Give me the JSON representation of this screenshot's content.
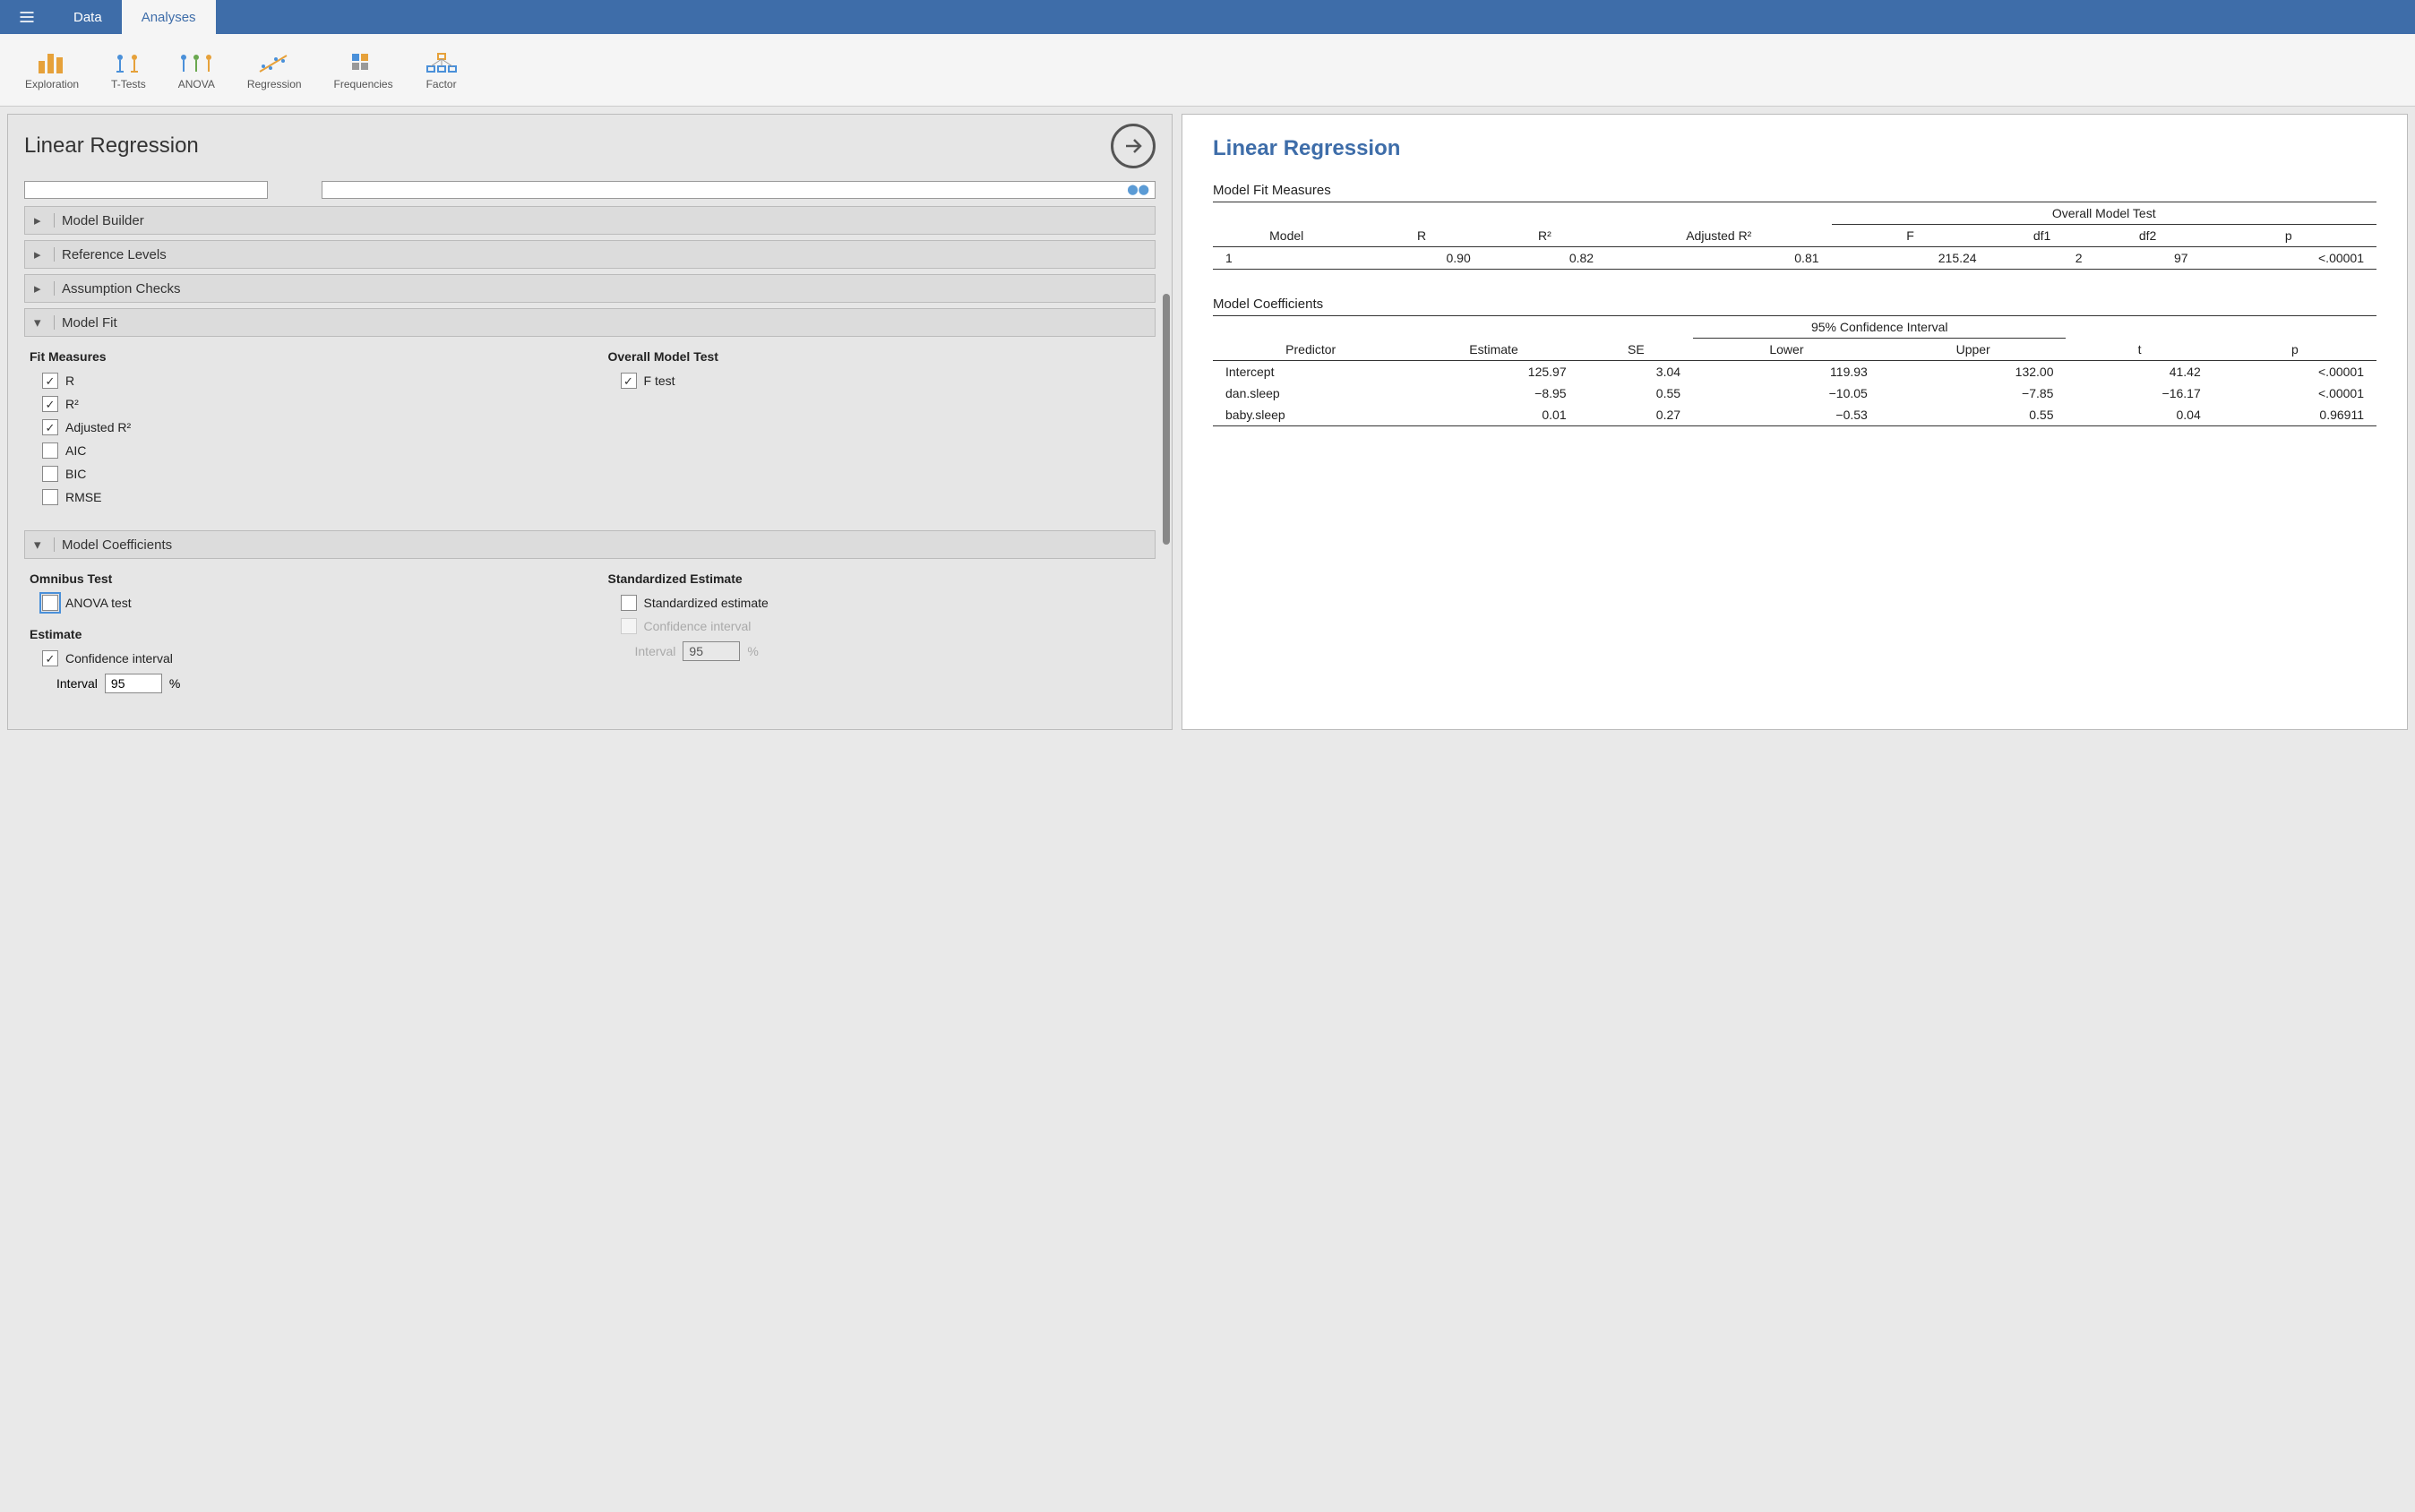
{
  "topbar": {
    "tabs": [
      "Data",
      "Analyses"
    ],
    "active_tab": 1
  },
  "ribbon": {
    "items": [
      "Exploration",
      "T-Tests",
      "ANOVA",
      "Regression",
      "Frequencies",
      "Factor"
    ]
  },
  "options_panel": {
    "title": "Linear Regression",
    "sections": {
      "model_builder": "Model Builder",
      "reference_levels": "Reference Levels",
      "assumption_checks": "Assumption Checks",
      "model_fit": "Model Fit",
      "model_coefficients": "Model Coefficients"
    },
    "model_fit": {
      "fit_measures_title": "Fit Measures",
      "overall_test_title": "Overall Model Test",
      "r": "R",
      "r2": "R²",
      "adj_r2": "Adjusted R²",
      "aic": "AIC",
      "bic": "BIC",
      "rmse": "RMSE",
      "ftest": "F test"
    },
    "model_coefficients": {
      "omnibus_title": "Omnibus Test",
      "anova_test": "ANOVA test",
      "estimate_title": "Estimate",
      "ci": "Confidence interval",
      "interval_label": "Interval",
      "percent": "%",
      "ci_value": "95",
      "std_title": "Standardized Estimate",
      "std_est": "Standardized estimate",
      "std_ci": "Confidence interval",
      "std_interval_label": "Interval",
      "std_ci_value": "95"
    }
  },
  "results": {
    "title": "Linear Regression",
    "model_fit": {
      "title": "Model Fit Measures",
      "spanner": "Overall Model Test",
      "headers": [
        "Model",
        "R",
        "R²",
        "Adjusted R²",
        "F",
        "df1",
        "df2",
        "p"
      ],
      "rows": [
        {
          "model": "1",
          "r": "0.90",
          "r2": "0.82",
          "adjr2": "0.81",
          "f": "215.24",
          "df1": "2",
          "df2": "97",
          "p": "<.00001"
        }
      ]
    },
    "coefficients": {
      "title": "Model Coefficients",
      "spanner": "95% Confidence Interval",
      "headers": [
        "Predictor",
        "Estimate",
        "SE",
        "Lower",
        "Upper",
        "t",
        "p"
      ],
      "rows": [
        {
          "predictor": "Intercept",
          "estimate": "125.97",
          "se": "3.04",
          "lower": "119.93",
          "upper": "132.00",
          "t": "41.42",
          "p": "<.00001"
        },
        {
          "predictor": "dan.sleep",
          "estimate": "−8.95",
          "se": "0.55",
          "lower": "−10.05",
          "upper": "−7.85",
          "t": "−16.17",
          "p": "<.00001"
        },
        {
          "predictor": "baby.sleep",
          "estimate": "0.01",
          "se": "0.27",
          "lower": "−0.53",
          "upper": "0.55",
          "t": "0.04",
          "p": "0.96911"
        }
      ]
    }
  }
}
